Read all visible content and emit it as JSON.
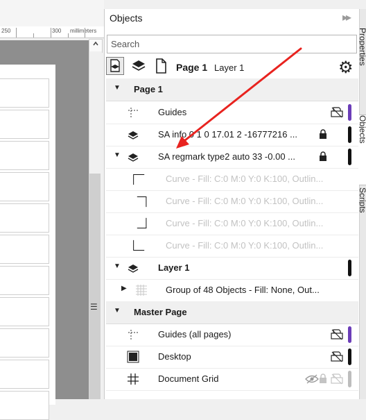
{
  "ruler": {
    "mark_250": "250",
    "mark_300": "300",
    "unit": "millimeters"
  },
  "docker": {
    "title": "Objects",
    "collapse_icon": "double-chevron-right-icon"
  },
  "search": {
    "placeholder": "Search",
    "value": ""
  },
  "toolbar": {
    "page": "Page 1",
    "layer": "Layer 1"
  },
  "tree": {
    "page1": "Page 1",
    "guides": "Guides",
    "sa_info": "SA info 0 1 0 17.01 2 -16777216 ...",
    "sa_regmark": "SA regmark type2 auto 33 -0.00 ...",
    "curves": [
      "Curve - Fill: C:0 M:0 Y:0 K:100, Outlin...",
      "Curve - Fill: C:0 M:0 Y:0 K:100, Outlin...",
      "Curve - Fill: C:0 M:0 Y:0 K:100, Outlin...",
      "Curve - Fill: C:0 M:0 Y:0 K:100, Outlin..."
    ],
    "layer1": "Layer 1",
    "group": "Group of 48 Objects - Fill: None, Out...",
    "master_page": "Master Page",
    "guides_all": "Guides (all pages)",
    "desktop": "Desktop",
    "document_grid": "Document Grid"
  },
  "side_tabs": {
    "properties": "Properties",
    "objects": "Objects",
    "scripts": "Scripts"
  },
  "colors": {
    "layer_purple": "#6b3db8",
    "arrow_red": "#e8231f",
    "layer_black": "#111111"
  }
}
